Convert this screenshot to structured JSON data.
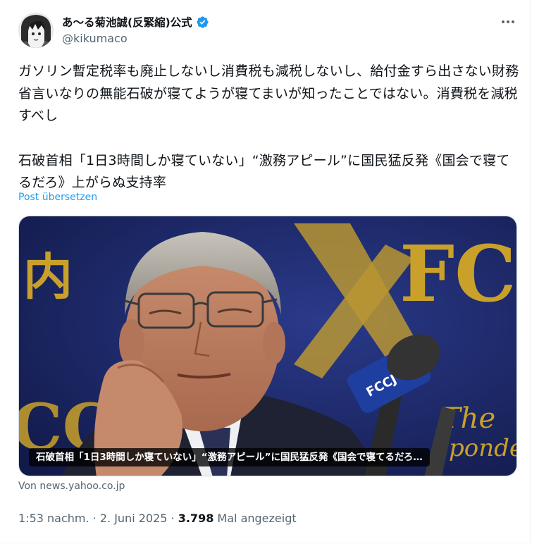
{
  "author": {
    "display_name": "あ〜る菊池誠(反緊縮)公式",
    "handle": "@kikumaco",
    "verified": true,
    "avatar_icon": "avatar-anime-portrait"
  },
  "tweet": {
    "text_line1": "ガソリン暫定税率も廃止しないし消費税も減税しないし、給付金すら出さない財務省言いなりの無能石破が寝てようが寝てまいが知ったことではない。消費税を減税すべし",
    "quoted_headline": "石破首相「1日3時間しか寝ていない」“激務アピール”に国民猛反発《国会で寝てるだろ》上がらぬ支持率",
    "translate_label": "Post übersetzen"
  },
  "card": {
    "caption": "石破首相「1日3時間しか寝ていない」“激務アピール”に国民猛反発《国会で寝てるだろ…",
    "source": "Von news.yahoo.co.jp",
    "background_text": "FCC",
    "left_kanji": "内",
    "mic_label": "FCCJ"
  },
  "meta": {
    "time": "1:53 nachm.",
    "date": "2. Juni 2025",
    "views_count": "3.798",
    "views_label": "Mal angezeigt",
    "separator": " · "
  },
  "colors": {
    "link": "#1d9bf0",
    "secondary_text": "#536471",
    "verified_badge": "#1d9bf0",
    "backdrop_navy": "#1c2a6e",
    "backdrop_gold": "#c9a12a"
  },
  "icons": {
    "more": "more-horizontal-icon",
    "verified": "verified-badge-icon"
  }
}
